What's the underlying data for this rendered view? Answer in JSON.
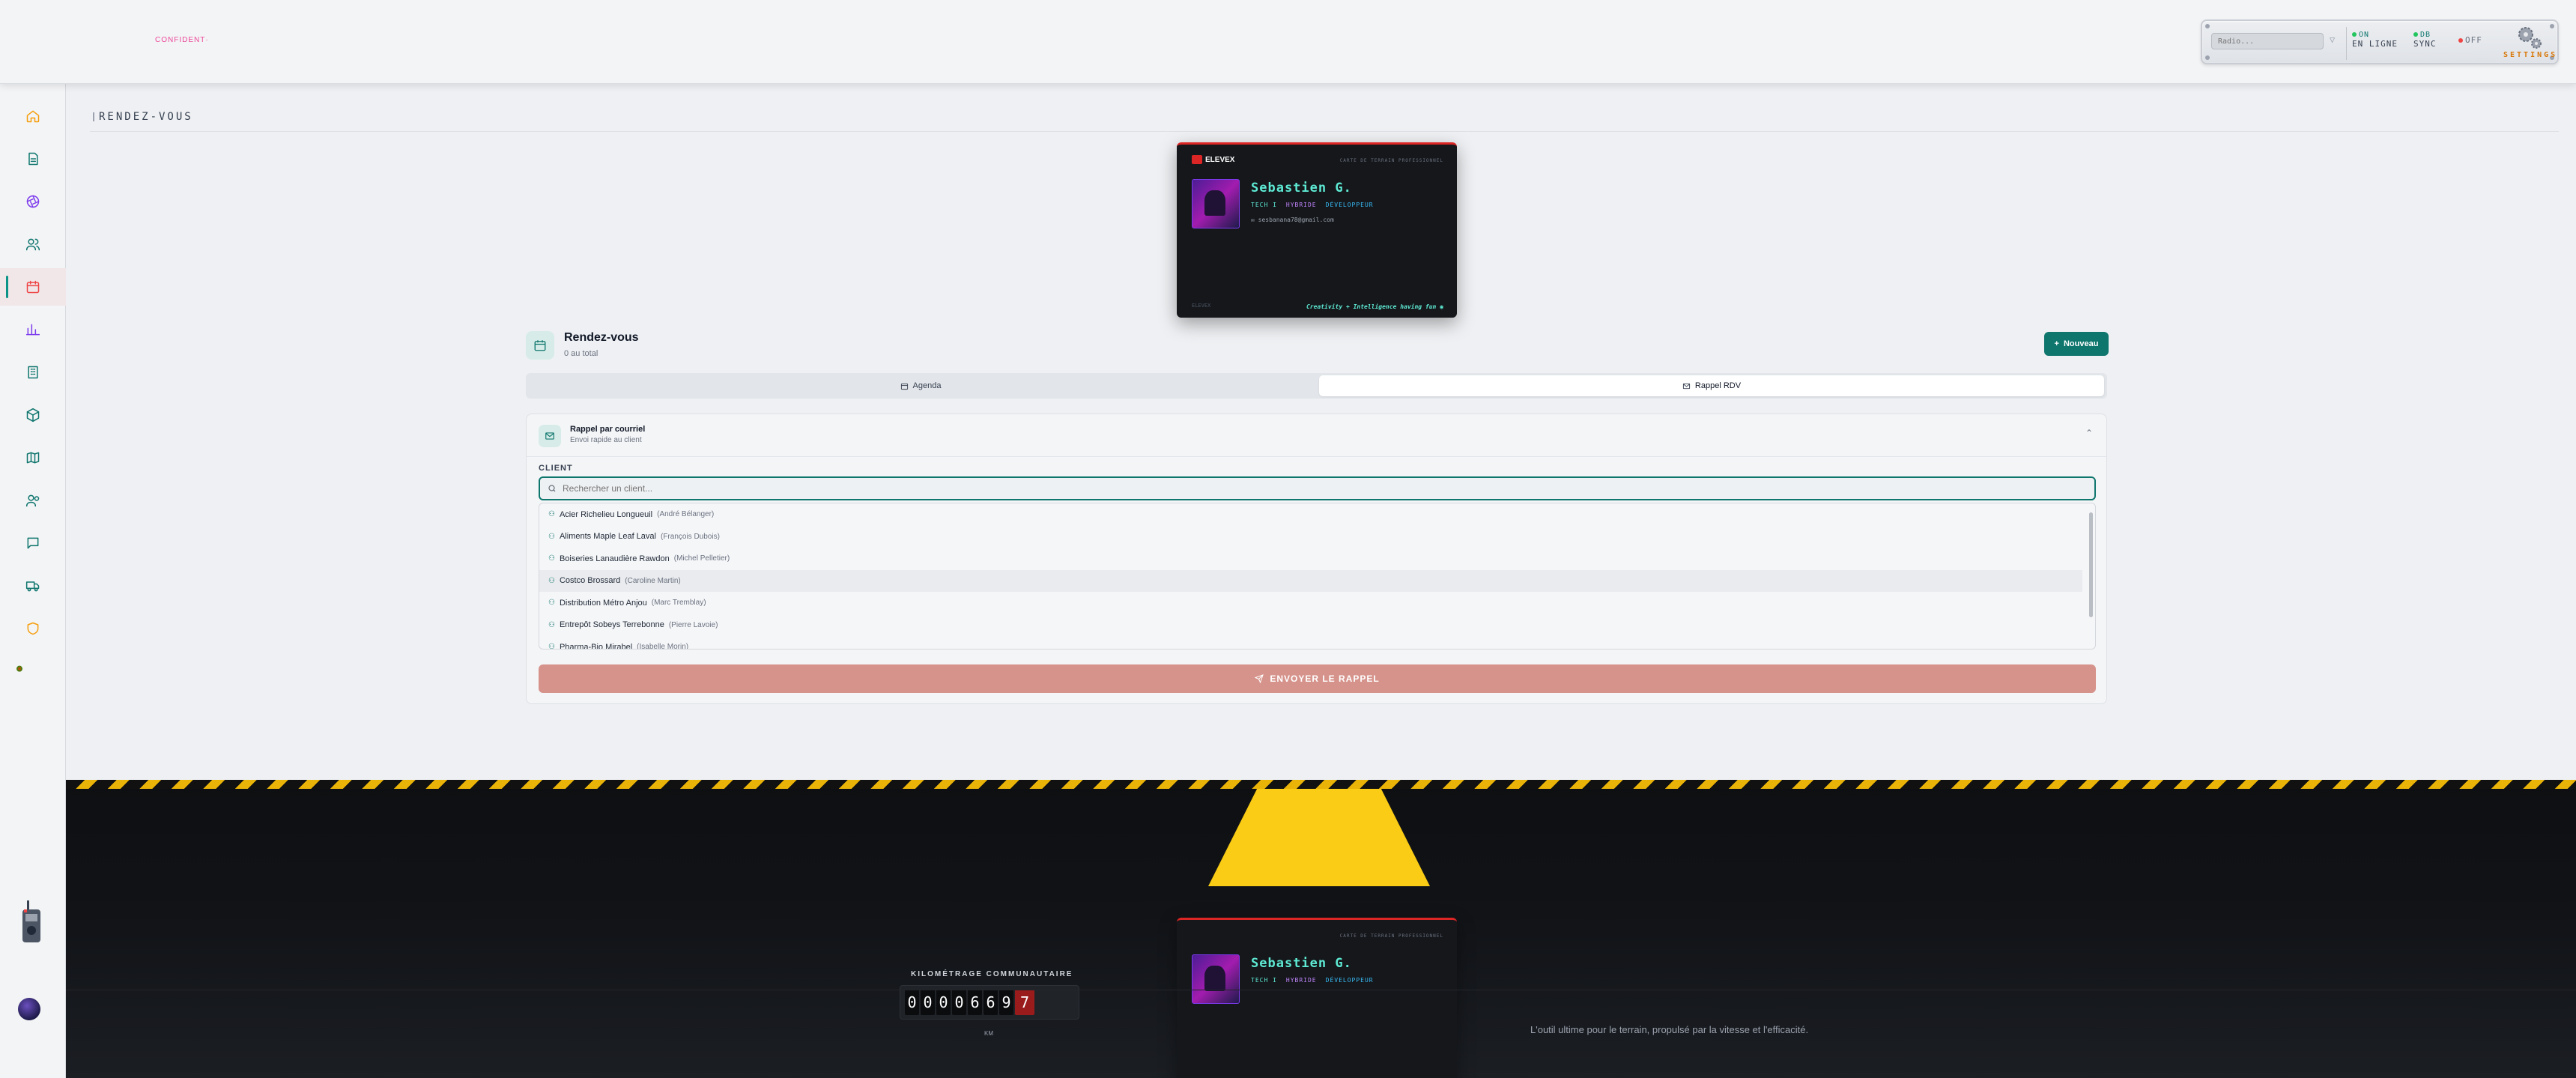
{
  "app": {
    "brand": "CONFIDENT·"
  },
  "radio": {
    "placeholder": "Radio...",
    "status": {
      "line1": "ON",
      "label": "EN LIGNE",
      "color": "#22c55e"
    },
    "db": {
      "line1": "DB",
      "label": "SYNC",
      "color": "#22c55e"
    },
    "off_label": "OFF",
    "settings_label": "SETTINGS"
  },
  "sidebar": {
    "items": [
      {
        "name": "home-icon",
        "color": "#f59e0b"
      },
      {
        "name": "document-icon",
        "color": "#0f766e"
      },
      {
        "name": "aperture-icon",
        "color": "#7c3aed"
      },
      {
        "name": "users-icon",
        "color": "#0f766e"
      },
      {
        "name": "calendar-icon",
        "color": "#ef4444",
        "active": true
      },
      {
        "name": "chart-icon",
        "color": "#7c3aed"
      },
      {
        "name": "building-icon",
        "color": "#0f766e"
      },
      {
        "name": "package-icon",
        "color": "#0f766e"
      },
      {
        "name": "map-icon",
        "color": "#0f766e"
      },
      {
        "name": "team-icon",
        "color": "#0f766e"
      },
      {
        "name": "message-icon",
        "color": "#0f766e"
      },
      {
        "name": "truck-icon",
        "color": "#0f766e"
      },
      {
        "name": "shield-icon",
        "color": "#f59e0b"
      }
    ]
  },
  "page": {
    "title": "RENDEZ-VOUS"
  },
  "card": {
    "logo": "ELEVEX",
    "tag": "CARTE DE TERRAIN PROFESSIONNEL",
    "name": "Sebastien G.",
    "roles": [
      {
        "label": "TECH I",
        "color": "#5eead4"
      },
      {
        "label": "HYBRIDE",
        "color": "#c084fc"
      },
      {
        "label": "DÉVELOPPEUR",
        "color": "#38bdf8"
      }
    ],
    "email": "sesbanana78@gmail.com",
    "footer_left": "ELEVEX",
    "footer_right": "Creativity + Intelligence having fun ◉"
  },
  "rdv": {
    "title": "Rendez-vous",
    "subtitle": "0 au total",
    "new_button": "Nouveau",
    "tabs": [
      {
        "label": "Agenda",
        "icon": "calendar-icon",
        "active": false
      },
      {
        "label": "Rappel RDV",
        "icon": "mail-icon",
        "active": true
      }
    ]
  },
  "reminder": {
    "title": "Rappel par courriel",
    "subtitle": "Envoi rapide au client",
    "client_label": "CLIENT",
    "search_placeholder": "Rechercher un client...",
    "clients": [
      {
        "name": "Acier Richelieu Longueuil",
        "contact": "(André Bélanger)"
      },
      {
        "name": "Aliments Maple Leaf Laval",
        "contact": "(François Dubois)"
      },
      {
        "name": "Boiseries Lanaudière Rawdon",
        "contact": "(Michel Pelletier)"
      },
      {
        "name": "Costco Brossard",
        "contact": "(Caroline Martin)"
      },
      {
        "name": "Distribution Métro Anjou",
        "contact": "(Marc Tremblay)"
      },
      {
        "name": "Entrepôt Sobeys Terrebonne",
        "contact": "(Pierre Lavoie)"
      },
      {
        "name": "Pharma-Bio Mirabel",
        "contact": "(Isabelle Morin)"
      }
    ],
    "send_button": "ENVOYER LE RAPPEL"
  },
  "footer": {
    "odometer_label": "KILOMÉTRAGE COMMUNAUTAIRE",
    "odometer_digits": [
      "0",
      "0",
      "0",
      "0",
      "6",
      "6",
      "9",
      "7"
    ],
    "odometer_unit": "KM",
    "tagline": "L'outil ultime pour le terrain, propulsé par la vitesse et l'efficacité."
  }
}
